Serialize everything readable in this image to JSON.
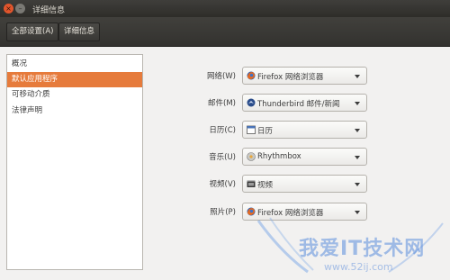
{
  "window": {
    "title": "详细信息"
  },
  "toolbar": {
    "all_settings": "全部设置(A)",
    "details": "详细信息"
  },
  "sidebar": {
    "items": [
      {
        "label": "概况"
      },
      {
        "label": "默认应用程序",
        "selected": true
      },
      {
        "label": "可移动介质"
      },
      {
        "label": "法律声明"
      }
    ]
  },
  "defaults": {
    "rows": [
      {
        "label": "网络(W)",
        "value": "Firefox 网络浏览器",
        "icon": "firefox-icon"
      },
      {
        "label": "邮件(M)",
        "value": "Thunderbird 邮件/新闻",
        "icon": "thunderbird-icon"
      },
      {
        "label": "日历(C)",
        "value": "日历",
        "icon": "calendar-icon"
      },
      {
        "label": "音乐(U)",
        "value": "Rhythmbox",
        "icon": "rhythmbox-icon"
      },
      {
        "label": "视频(V)",
        "value": "视频",
        "icon": "video-icon"
      },
      {
        "label": "照片(P)",
        "value": "Firefox 网络浏览器",
        "icon": "firefox-icon"
      }
    ]
  },
  "watermark": {
    "text": "我爱IT技术网",
    "url": "www.52ij.com"
  },
  "colors": {
    "accent": "#e67b3c",
    "titlebar": "#3c3b37"
  }
}
